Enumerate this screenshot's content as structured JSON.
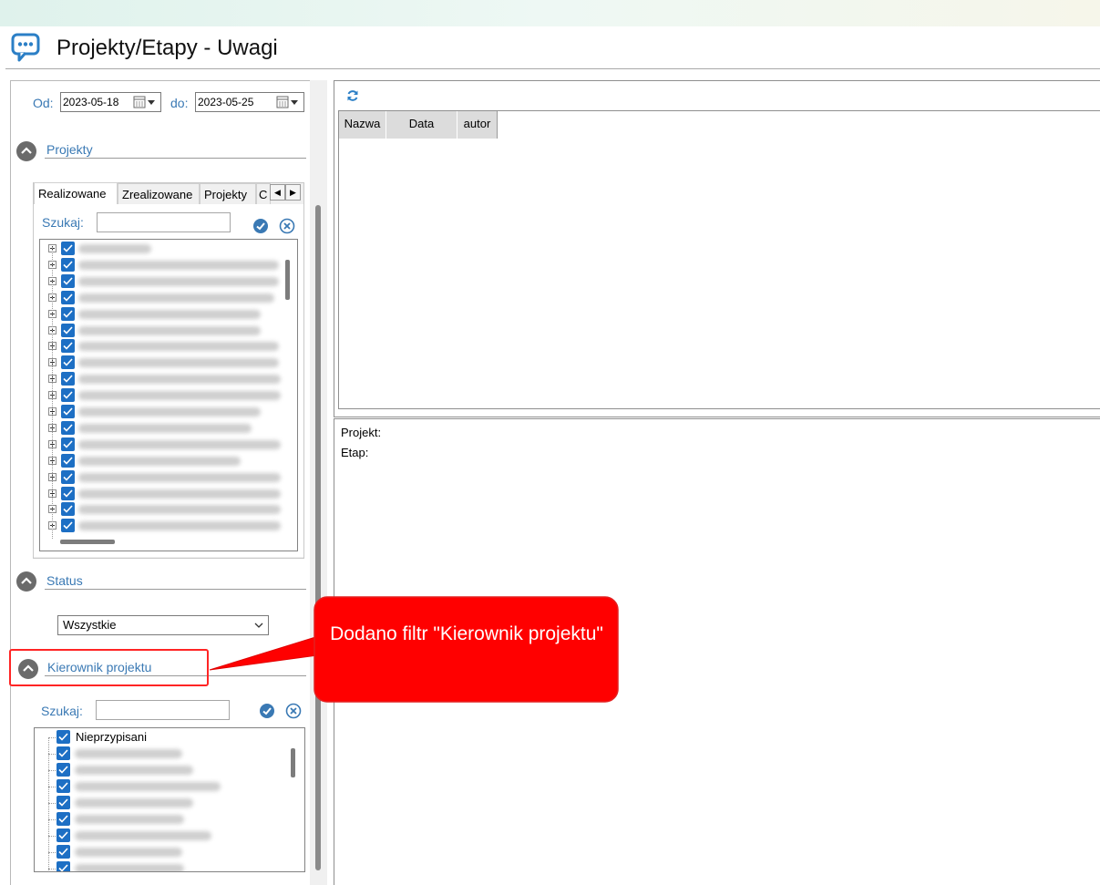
{
  "window": {
    "title": "Projekty/Etapy - Uwagi",
    "icon": "chat-bubble-icon"
  },
  "filters": {
    "from_label": "Od:",
    "from_value": "2023-05-18",
    "to_label": "do:",
    "to_value": "2023-05-25"
  },
  "projects": {
    "section_title": "Projekty",
    "tabs": [
      "Realizowane",
      "Zrealizowane",
      "Projekty",
      "C"
    ],
    "search_label": "Szukaj:",
    "search_value": ""
  },
  "status": {
    "section_title": "Status",
    "selected": "Wszystkie"
  },
  "manager": {
    "section_title": "Kierownik projektu",
    "search_label": "Szukaj:",
    "search_value": "",
    "first_item": "Nieprzypisani"
  },
  "grid": {
    "columns": [
      "Nazwa",
      "Data",
      "autor"
    ]
  },
  "details": {
    "project_label": "Projekt:",
    "stage_label": "Etap:"
  },
  "callout": {
    "text": "Dodano filtr \"Kierownik projektu\""
  },
  "colors": {
    "accent": "#3a79b4",
    "checkbox": "#1d6fc4",
    "callout": "#ff0000"
  }
}
